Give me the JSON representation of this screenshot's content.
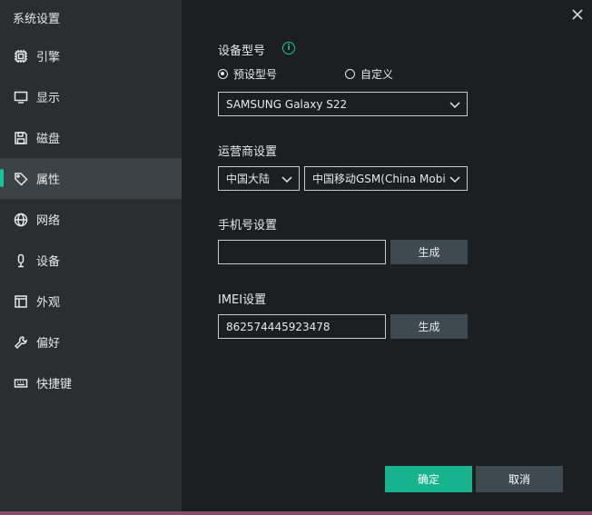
{
  "window": {
    "title": "系统设置"
  },
  "icons": {
    "close": "close-icon",
    "info": "info-icon",
    "dropdown": "chevron-down-icon"
  },
  "colors": {
    "accent": "#17c59a",
    "sidebar_bg": "#2a2e31",
    "main_bg": "#1b1f22",
    "active_item_bg": "#3d4246"
  },
  "sidebar": {
    "active_index": 3,
    "items": [
      {
        "label": "引擎",
        "icon": "chip-icon"
      },
      {
        "label": "显示",
        "icon": "monitor-icon"
      },
      {
        "label": "磁盘",
        "icon": "save-icon"
      },
      {
        "label": "属性",
        "icon": "tag-icon"
      },
      {
        "label": "网络",
        "icon": "globe-icon"
      },
      {
        "label": "设备",
        "icon": "microphone-icon"
      },
      {
        "label": "外观",
        "icon": "window-icon"
      },
      {
        "label": "偏好",
        "icon": "wrench-icon"
      },
      {
        "label": "快捷键",
        "icon": "keyboard-icon"
      }
    ]
  },
  "device_model": {
    "label": "设备型号",
    "info_glyph": "i",
    "radio_preset": {
      "label": "预设型号",
      "checked": true
    },
    "radio_custom": {
      "label": "自定义",
      "checked": false
    },
    "selected_model": "SAMSUNG Galaxy S22"
  },
  "carrier": {
    "label": "运营商设置",
    "region": "中国大陆",
    "operator": "中国移动GSM(China Mobi"
  },
  "phone": {
    "label": "手机号设置",
    "value": "",
    "generate_label": "生成"
  },
  "imei": {
    "label": "IMEI设置",
    "value": "862574445923478",
    "generate_label": "生成"
  },
  "footer": {
    "confirm_label": "确定",
    "cancel_label": "取消"
  }
}
